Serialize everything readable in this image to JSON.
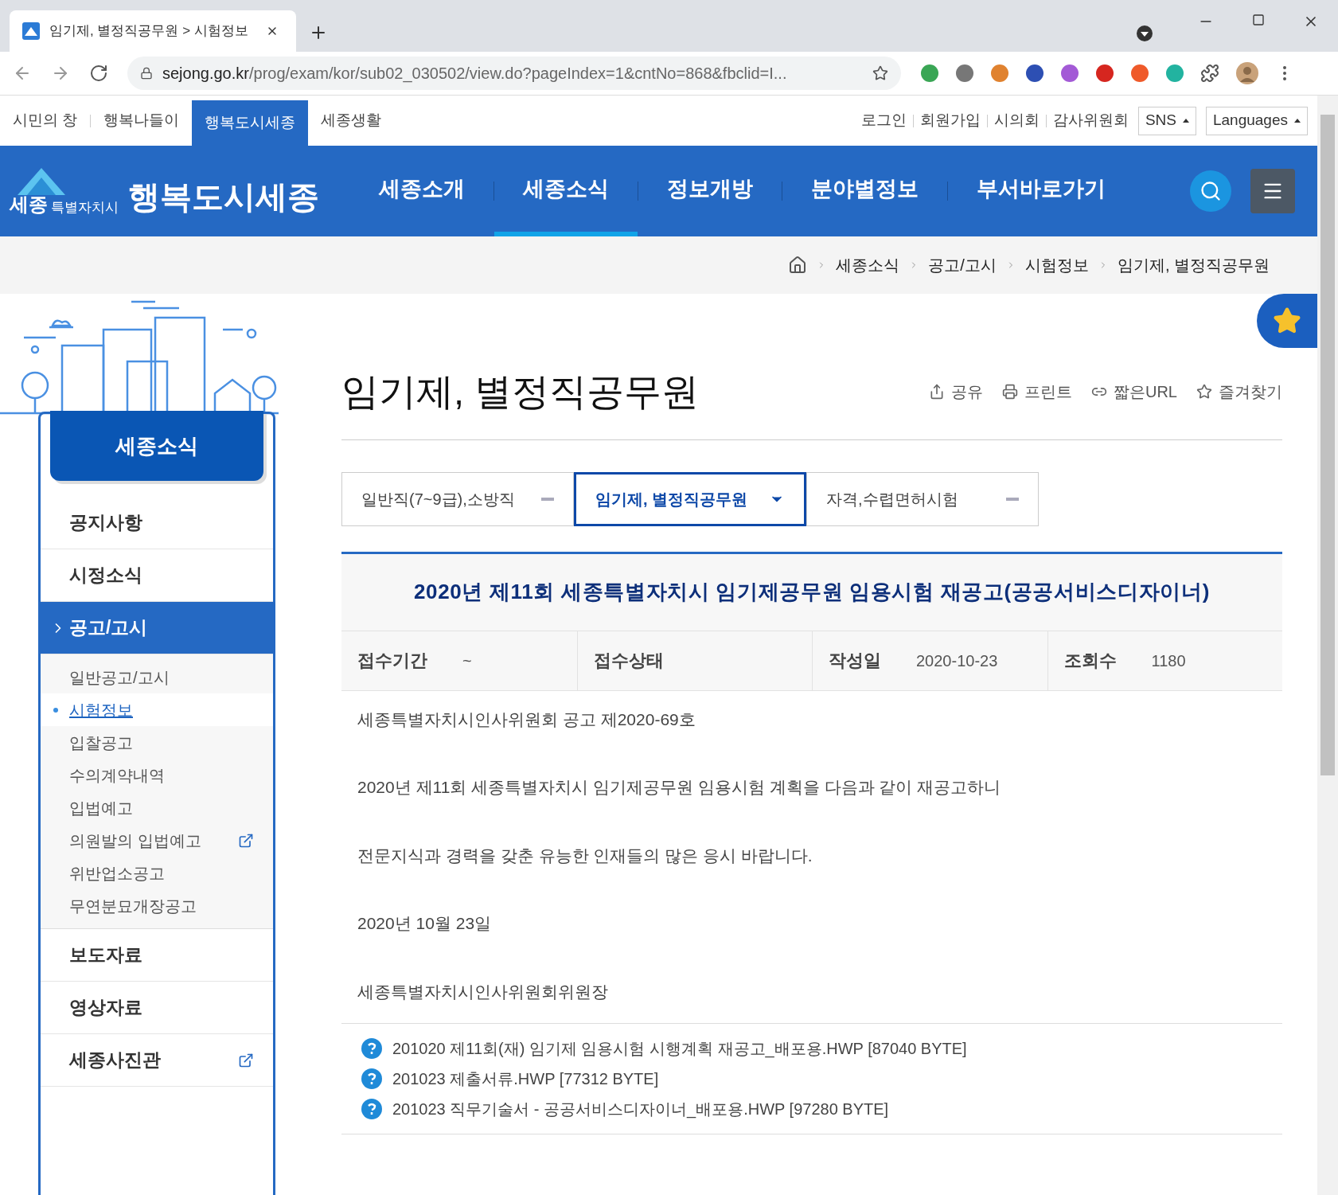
{
  "browser": {
    "tab_title": "임기제, 별정직공무원 > 시험정보",
    "url_host": "sejong.go.kr",
    "url_path": "/prog/exam/kor/sub02_030502/view.do?pageIndex=1&cntNo=868&fbclid=I..."
  },
  "top_links": [
    {
      "label": "시민의 창",
      "selected": false
    },
    {
      "label": "행복나들이",
      "selected": false
    },
    {
      "label": "행복도시세종",
      "selected": true
    },
    {
      "label": "세종생활",
      "selected": false
    }
  ],
  "util_links": [
    "로그인",
    "회원가입",
    "시의회",
    "감사위원회"
  ],
  "util_buttons": [
    "SNS",
    "Languages"
  ],
  "logo": {
    "small": "세종",
    "city": "특별자치시",
    "name": "행복도시세종"
  },
  "nav": [
    {
      "label": "세종소개",
      "selected": false
    },
    {
      "label": "세종소식",
      "selected": true
    },
    {
      "label": "정보개방",
      "selected": false
    },
    {
      "label": "분야별정보",
      "selected": false
    },
    {
      "label": "부서바로가기",
      "selected": false
    }
  ],
  "breadcrumb": [
    "세종소식",
    "공고/고시",
    "시험정보",
    "임기제, 별정직공무원"
  ],
  "sidebar": {
    "title": "세종소식",
    "items": [
      {
        "label": "공지사항",
        "selected": false,
        "external": false
      },
      {
        "label": "시정소식",
        "selected": false,
        "external": false
      },
      {
        "label": "공고/고시",
        "selected": true,
        "external": false,
        "children": [
          {
            "label": "일반공고/고시",
            "selected": false,
            "external": false
          },
          {
            "label": "시험정보",
            "selected": true,
            "external": false
          },
          {
            "label": "입찰공고",
            "selected": false,
            "external": false
          },
          {
            "label": "수의계약내역",
            "selected": false,
            "external": false
          },
          {
            "label": "입법예고",
            "selected": false,
            "external": false
          },
          {
            "label": "의원발의 입법예고",
            "selected": false,
            "external": true
          },
          {
            "label": "위반업소공고",
            "selected": false,
            "external": false
          },
          {
            "label": "무연분묘개장공고",
            "selected": false,
            "external": false
          }
        ]
      },
      {
        "label": "보도자료",
        "selected": false,
        "external": false
      },
      {
        "label": "영상자료",
        "selected": false,
        "external": false
      },
      {
        "label": "세종사진관",
        "selected": false,
        "external": true
      }
    ]
  },
  "page_title": "임기제, 별정직공무원",
  "page_tools": [
    {
      "kind": "share",
      "label": "공유"
    },
    {
      "kind": "print",
      "label": "프린트"
    },
    {
      "kind": "link",
      "label": "짧은URL"
    },
    {
      "kind": "star",
      "label": "즐겨찾기"
    }
  ],
  "tabs": [
    {
      "label": "일반직(7~9급),소방직",
      "selected": false
    },
    {
      "label": "임기제, 별정직공무원",
      "selected": true
    },
    {
      "label": "자격,수렵면허시험",
      "selected": false
    }
  ],
  "post": {
    "title": "2020년 제11회 세종특별자치시 임기제공무원 임용시험 재공고(공공서비스디자이너)",
    "meta": [
      {
        "label": "접수기간",
        "value": "~"
      },
      {
        "label": "접수상태"
      },
      {
        "label": "작성일",
        "value": "2020-10-23"
      },
      {
        "label": "조회수",
        "value": "1180"
      }
    ],
    "body": [
      "세종특별자치시인사위원회 공고 제2020-69호",
      "2020년 제11회 세종특별자치시 임기제공무원 임용시험 계획을 다음과 같이 재공고하니",
      "전문지식과 경력을 갖춘 유능한 인재들의 많은 응시 바랍니다.",
      "2020년 10월 23일",
      "세종특별자치시인사위원회위원장"
    ],
    "files": [
      "201020 제11회(재) 임기제 임용시험 시행계획 재공고_배포용.HWP [87040 BYTE]",
      "201023 제출서류.HWP [77312 BYTE]",
      "201023 직무기술서 - 공공서비스디자이너_배포용.HWP [97280 BYTE]"
    ]
  }
}
